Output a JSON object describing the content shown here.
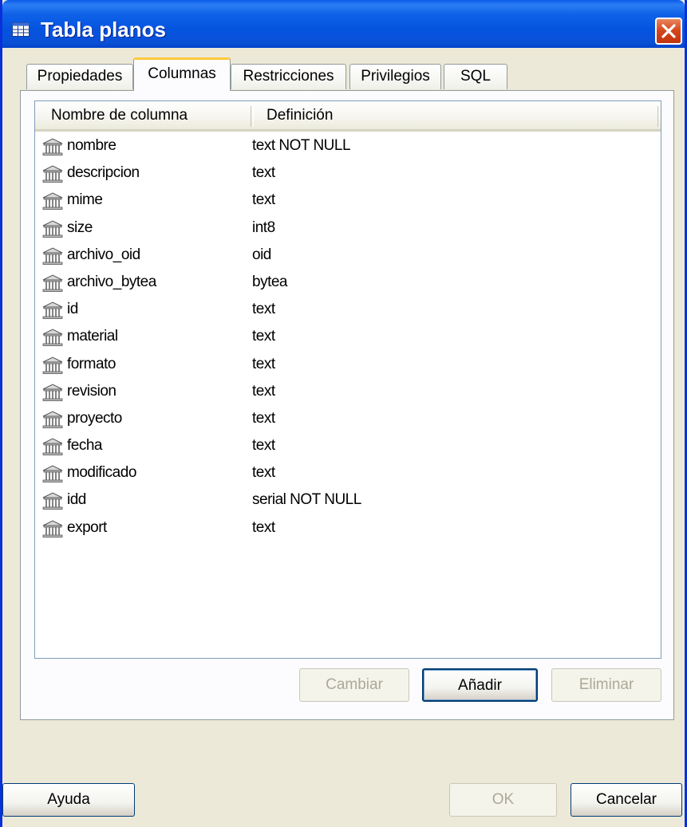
{
  "window": {
    "title": "Tabla planos",
    "title_icon": "table-icon",
    "close_icon": "close-icon"
  },
  "tabs": [
    {
      "label": "Propiedades",
      "active": false
    },
    {
      "label": "Columnas",
      "active": true
    },
    {
      "label": "Restricciones",
      "active": false
    },
    {
      "label": "Privilegios",
      "active": false
    },
    {
      "label": "SQL",
      "active": false
    }
  ],
  "columns_list": {
    "headers": {
      "name": "Nombre de columna",
      "definition": "Definición"
    },
    "row_icon": "column-icon",
    "rows": [
      {
        "name": "nombre",
        "definition": "text NOT NULL"
      },
      {
        "name": "descripcion",
        "definition": "text"
      },
      {
        "name": "mime",
        "definition": "text"
      },
      {
        "name": "size",
        "definition": "int8"
      },
      {
        "name": "archivo_oid",
        "definition": "oid"
      },
      {
        "name": "archivo_bytea",
        "definition": "bytea"
      },
      {
        "name": "id",
        "definition": "text"
      },
      {
        "name": "material",
        "definition": "text"
      },
      {
        "name": "formato",
        "definition": "text"
      },
      {
        "name": "revision",
        "definition": "text"
      },
      {
        "name": "proyecto",
        "definition": "text"
      },
      {
        "name": "fecha",
        "definition": "text"
      },
      {
        "name": "modificado",
        "definition": "text"
      },
      {
        "name": "idd",
        "definition": "serial NOT NULL"
      },
      {
        "name": "export",
        "definition": "text"
      }
    ]
  },
  "panel_buttons": {
    "change": "Cambiar",
    "add": "Añadir",
    "remove": "Eliminar"
  },
  "dialog_buttons": {
    "help": "Ayuda",
    "ok": "OK",
    "cancel": "Cancelar"
  },
  "colors": {
    "titlebar": "#0054e3",
    "tab_active_highlight": "#ffc83c",
    "close_button": "#d4451a"
  }
}
